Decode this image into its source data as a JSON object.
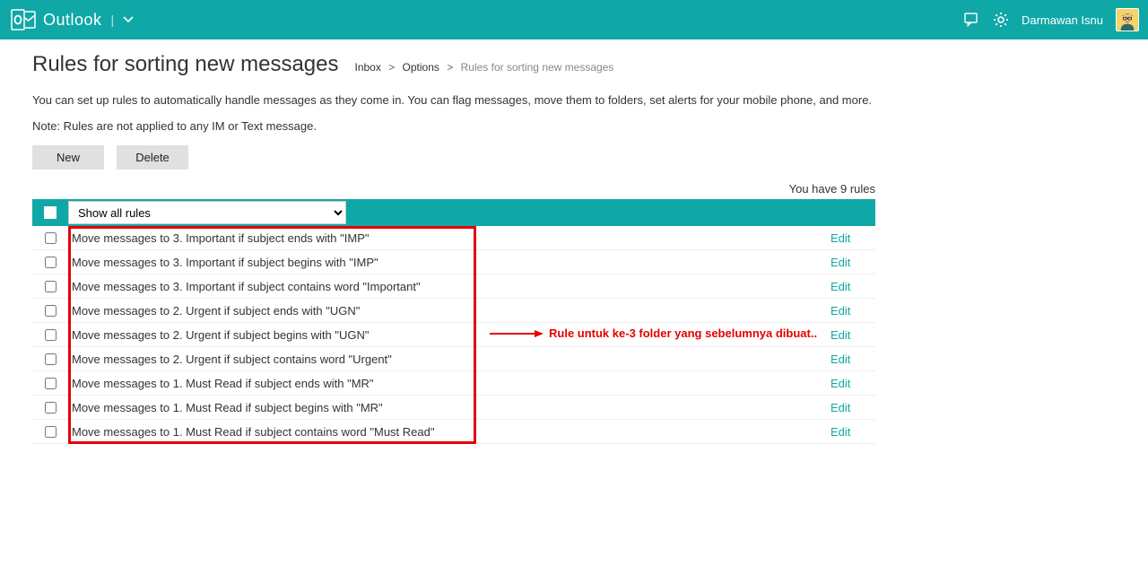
{
  "colors": {
    "accent": "#0fa8a6",
    "highlight": "#e60000"
  },
  "header": {
    "brand_name": "Outlook",
    "username": "Darmawan Isnu"
  },
  "page": {
    "title": "Rules for sorting new messages",
    "breadcrumb": {
      "inbox": "Inbox",
      "options": "Options",
      "current": "Rules for sorting new messages"
    },
    "intro": "You can set up rules to automatically handle messages as they come in. You can flag messages, move them to folders, set alerts for your mobile phone, and more.",
    "note": "Note: Rules are not applied to any IM or Text message.",
    "buttons": {
      "new": "New",
      "delete": "Delete"
    },
    "count_text": "You have 9 rules",
    "filter": {
      "selected": "Show all rules",
      "options": [
        "Show all rules"
      ]
    },
    "edit_label": "Edit",
    "rules": [
      "Move messages to 3. Important if subject ends with \"IMP\"",
      "Move messages to 3. Important if subject begins with \"IMP\"",
      "Move messages to 3. Important if subject contains word \"Important\"",
      "Move messages to 2. Urgent if subject ends with \"UGN\"",
      "Move messages to 2. Urgent if subject begins with \"UGN\"",
      "Move messages to 2. Urgent if subject contains word \"Urgent\"",
      "Move messages to 1. Must Read if subject ends with \"MR\"",
      "Move messages to 1. Must Read if subject begins with \"MR\"",
      "Move messages to 1. Must Read if subject contains word \"Must Read\""
    ],
    "annotation": "Rule untuk ke-3 folder yang sebelumnya dibuat.."
  }
}
